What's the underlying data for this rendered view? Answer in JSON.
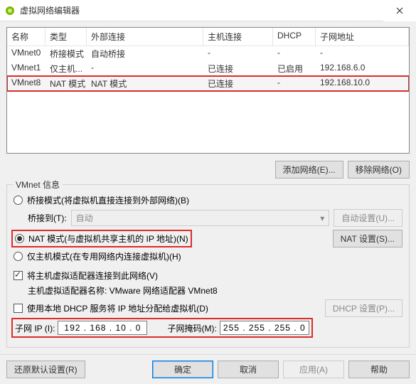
{
  "titlebar": {
    "title": "虚拟网络编辑器"
  },
  "table": {
    "headers": {
      "name": "名称",
      "type": "类型",
      "ext": "外部连接",
      "host": "主机连接",
      "dhcp": "DHCP",
      "subnet": "子网地址"
    },
    "rows": [
      {
        "name": "VMnet0",
        "type": "桥接模式",
        "ext": "自动桥接",
        "host": "-",
        "dhcp": "-",
        "subnet": "-"
      },
      {
        "name": "VMnet1",
        "type": "仅主机...",
        "ext": "-",
        "host": "已连接",
        "dhcp": "已启用",
        "subnet": "192.168.6.0"
      },
      {
        "name": "VMnet8",
        "type": "NAT 模式",
        "ext": "NAT 模式",
        "host": "已连接",
        "dhcp": "-",
        "subnet": "192.168.10.0"
      }
    ]
  },
  "buttons": {
    "add_network": "添加网络(E)...",
    "remove_network": "移除网络(O)"
  },
  "group": {
    "title": "VMnet 信息",
    "bridged": "桥接模式(将虚拟机直接连接到外部网络)(B)",
    "bridged_to_label": "桥接到(T):",
    "bridged_to_value": "自动",
    "auto_settings": "自动设置(U)...",
    "nat": "NAT 模式(与虚拟机共享主机的 IP 地址)(N)",
    "nat_settings": "NAT 设置(S)...",
    "hostonly": "仅主机模式(在专用网络内连接虚拟机)(H)",
    "connect_adapter": "将主机虚拟适配器连接到此网络(V)",
    "adapter_name_label": "主机虚拟适配器名称: VMware 网络适配器 VMnet8",
    "use_dhcp": "使用本地 DHCP 服务将 IP 地址分配给虚拟机(D)",
    "dhcp_settings": "DHCP 设置(P)...",
    "subnet_ip_label": "子网 IP (I):",
    "subnet_ip_value": "192 . 168 . 10  .  0",
    "subnet_mask_label": "子网掩码(M):",
    "subnet_mask_value": "255 . 255 . 255 .  0"
  },
  "bottom": {
    "restore": "还原默认设置(R)",
    "ok": "确定",
    "cancel": "取消",
    "apply": "应用(A)",
    "help": "帮助"
  }
}
